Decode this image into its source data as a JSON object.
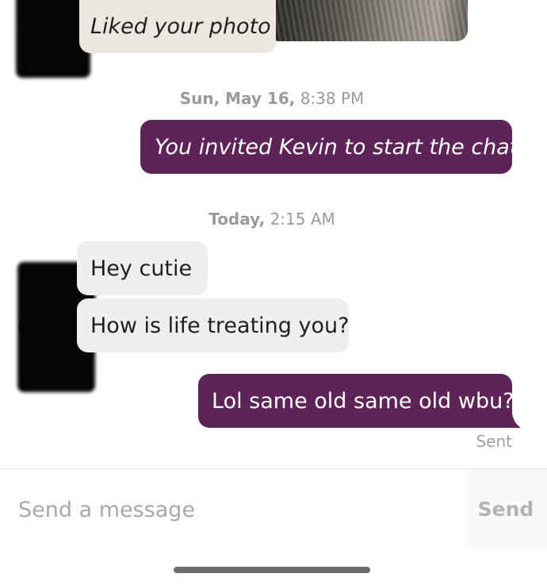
{
  "messages": {
    "like_text": "Liked your photo",
    "timestamp1": {
      "day": "Sun, May 16,",
      "time": "8:38 PM"
    },
    "invite_text": "You invited Kevin to start the chat",
    "timestamp2": {
      "day": "Today,",
      "time": "2:15 AM"
    },
    "incoming": [
      "Hey cutie",
      "How is life treating you?"
    ],
    "outgoing": "Lol same old same old wbu?",
    "status": "Sent"
  },
  "composer": {
    "placeholder": "Send a message",
    "send_label": "Send"
  },
  "colors": {
    "outgoing_bubble": "#5c2457",
    "incoming_bubble": "#eeeeee",
    "like_bubble": "#ece6e1"
  }
}
